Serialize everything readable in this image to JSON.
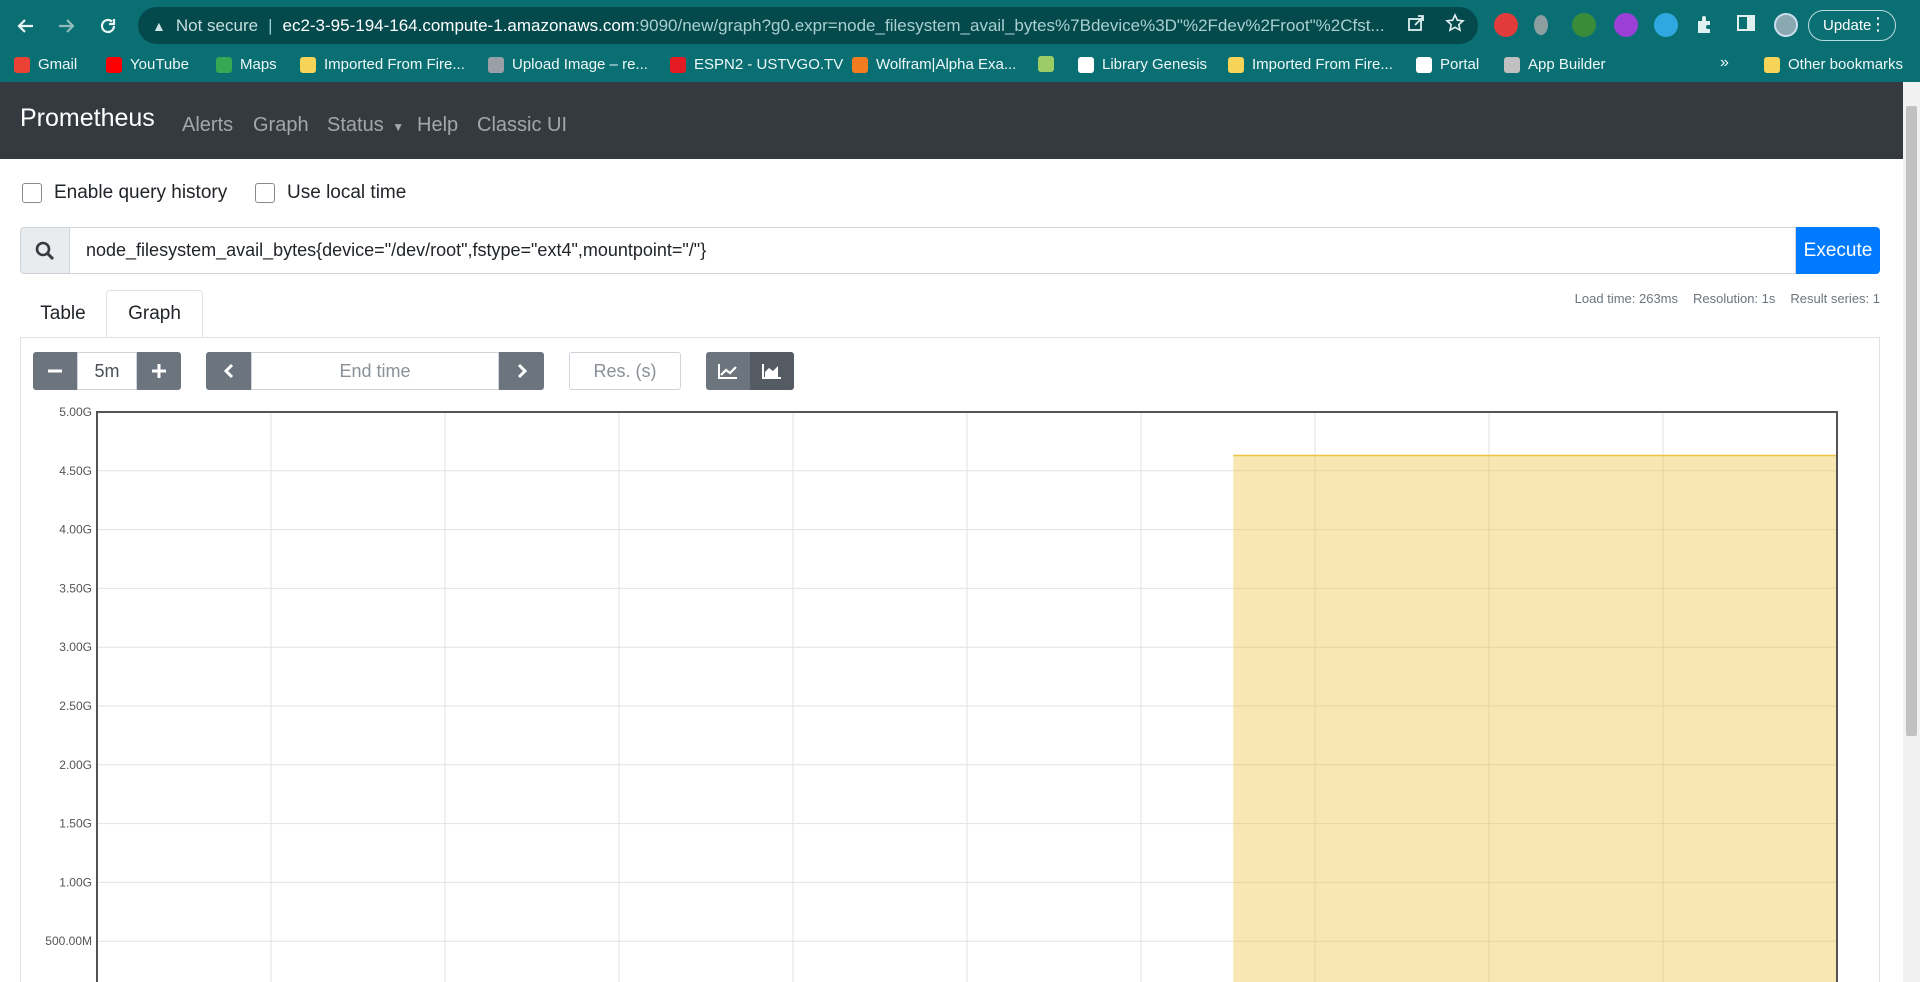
{
  "browser": {
    "url": {
      "warning": "Not secure",
      "host": "ec2-3-95-194-164.compute-1.amazonaws.com",
      "path": ":9090/new/graph?g0.expr=node_filesystem_avail_bytes%7Bdevice%3D\"%2Fdev%2Froot\"%2Cfst..."
    },
    "update_label": "Update",
    "bookmarks": [
      {
        "label": "Gmail",
        "color": "#ea4335"
      },
      {
        "label": "YouTube",
        "color": "#ff0000"
      },
      {
        "label": "Maps",
        "color": "#34a853"
      },
      {
        "label": "Imported From Fire...",
        "color": "#f7d358"
      },
      {
        "label": "Upload Image – re...",
        "color": "#9aa0a6"
      },
      {
        "label": "ESPN2 - USTVGO.TV",
        "color": "#e51b24"
      },
      {
        "label": "Wolfram|Alpha Exa...",
        "color": "#f47c20"
      },
      {
        "label": "",
        "color": "#9ccc65"
      },
      {
        "label": "Library Genesis",
        "color": "#ffffff"
      },
      {
        "label": "Imported From Fire...",
        "color": "#f7d358"
      },
      {
        "label": "Portal",
        "color": "#ffffff"
      },
      {
        "label": "App Builder",
        "color": "#c0c0c0"
      }
    ],
    "overflow_label": "»",
    "other_bookmarks": "Other bookmarks"
  },
  "navbar": {
    "brand": "Prometheus",
    "links": {
      "alerts": "Alerts",
      "graph": "Graph",
      "status": "Status",
      "help": "Help",
      "classic": "Classic UI"
    }
  },
  "options": {
    "query_history": "Enable query history",
    "local_time": "Use local time"
  },
  "query": {
    "expression": "node_filesystem_avail_bytes{device=\"/dev/root\",fstype=\"ext4\",mountpoint=\"/\"}",
    "execute_label": "Execute"
  },
  "tabs": {
    "table": "Table",
    "graph": "Graph",
    "active": "Graph"
  },
  "stats": {
    "load_time": "Load time: 263ms",
    "resolution": "Resolution: 1s",
    "result_series": "Result series: 1"
  },
  "graph_controls": {
    "range": "5m",
    "end_time_placeholder": "End time",
    "resolution_placeholder": "Res. (s)"
  },
  "chart_data": {
    "type": "area",
    "y_ticks": [
      "5.00G",
      "4.50G",
      "4.00G",
      "3.50G",
      "3.00G",
      "2.50G",
      "2.00G",
      "1.50G",
      "1.00G",
      "500.00M"
    ],
    "ylim": [
      0,
      5.0
    ],
    "y_unit": "G",
    "x_divisions": 10,
    "x_start_fraction": 0.653,
    "series": [
      {
        "value": 4.63,
        "color": "#edc240"
      }
    ]
  }
}
